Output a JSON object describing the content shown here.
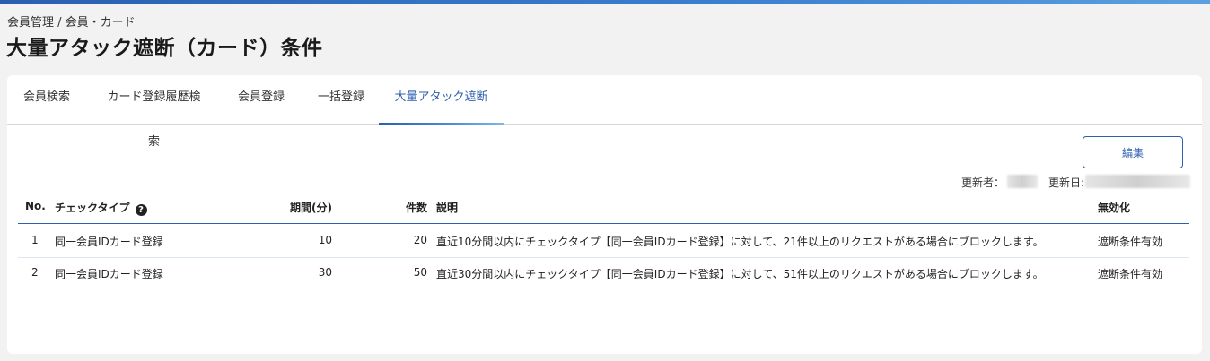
{
  "breadcrumb": "会員管理 / 会員・カード",
  "page_title": "大量アタック遮断（カード）条件",
  "tabs": [
    {
      "label": "会員検索",
      "active": false
    },
    {
      "label": "カード登録履歴検索",
      "active": false
    },
    {
      "label": "会員登録",
      "active": false
    },
    {
      "label": "一括登録",
      "active": false
    },
    {
      "label": "大量アタック遮断",
      "active": true
    }
  ],
  "toolbar": {
    "edit_label": "編集"
  },
  "meta": {
    "updated_by_label": "更新者：",
    "updated_at_label": "更新日:"
  },
  "table": {
    "headers": {
      "no": "No.",
      "check_type": "チェックタイプ",
      "period": "期間(分)",
      "count": "件数",
      "description": "説明",
      "disabled": "無効化"
    },
    "help_icon_glyph": "?",
    "rows": [
      {
        "no": "1",
        "check_type": "同一会員IDカード登録",
        "period": "10",
        "count": "20",
        "description": "直近10分間以内にチェックタイプ【同一会員IDカード登録】に対して、21件以上のリクエストがある場合にブロックします。",
        "disabled": "遮断条件有効"
      },
      {
        "no": "2",
        "check_type": "同一会員IDカード登録",
        "period": "30",
        "count": "50",
        "description": "直近30分間以内にチェックタイプ【同一会員IDカード登録】に対して、51件以上のリクエストがある場合にブロックします。",
        "disabled": "遮断条件有効"
      }
    ]
  },
  "colors": {
    "accent": "#2f5fae",
    "header_line": "#2f5fae"
  }
}
